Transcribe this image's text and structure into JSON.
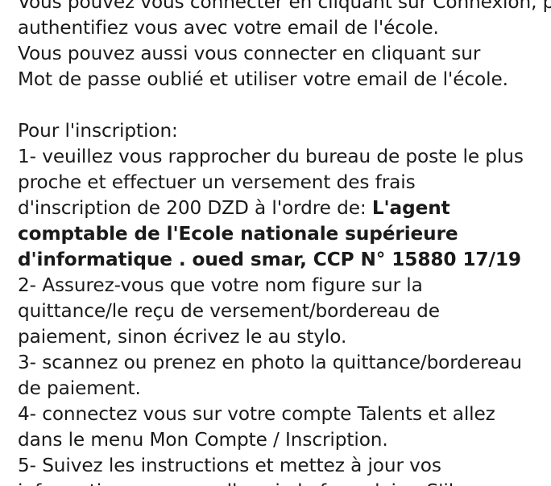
{
  "intro_lines": [
    "Vous pouvez vous connecter en cliquant sur Connexion, puis",
    "authentifiez vous avec votre email de l'école.",
    "Vous pouvez aussi vous connecter en cliquant sur",
    "Mot de passe oublié et utiliser votre email de l'école."
  ],
  "inscription_heading": "Pour l'inscription:",
  "step1": {
    "line1": "1- veuillez vous rapprocher du bureau de poste le plus",
    "line2": "proche et effectuer un versement des frais",
    "line3_normal": "d'inscription de 200 DZD à l'ordre de: ",
    "line3_bold": "L'agent",
    "line4_bold": "comptable de l'Ecole nationale supérieure",
    "line5_bold": "d'informatique . oued smar, CCP N° 15880 17/19"
  },
  "step2": {
    "line1": "2- Assurez-vous que votre nom figure sur la",
    "line2": "quittance/le reçu de versement/bordereau de",
    "line3": "paiement, sinon écrivez le au stylo."
  },
  "step3": {
    "line1": "3- scannez ou prenez en photo la quittance/bordereau",
    "line2": "de paiement."
  },
  "step4": {
    "line1": "4- connectez vous sur votre compte Talents et allez",
    "line2": "dans le menu Mon Compte / Inscription."
  },
  "step5": {
    "line1": "5- Suivez les instructions et mettez à jour vos",
    "line2": "informations personnelles via le formulaire. S'il n y a"
  }
}
